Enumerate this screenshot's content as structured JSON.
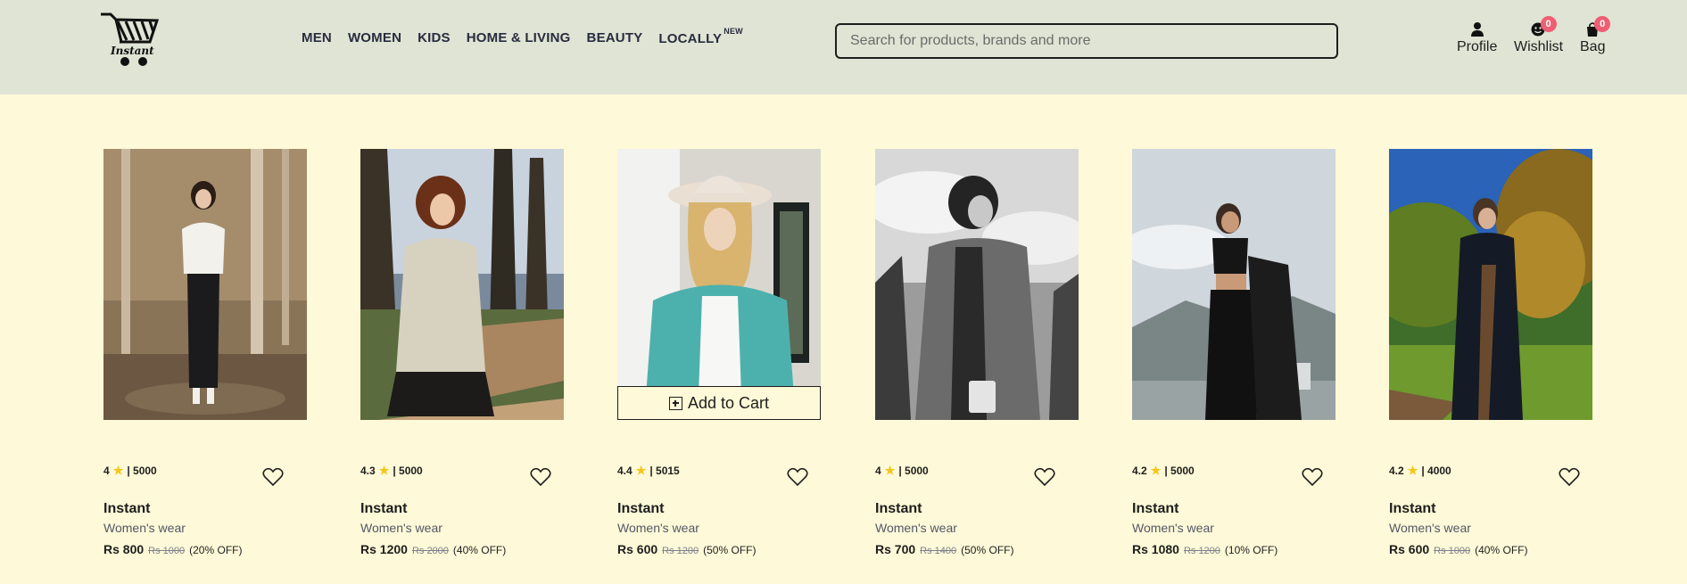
{
  "brand_logo": {
    "text": "Instant",
    "icon": "shopping-cart-logo"
  },
  "nav": [
    {
      "label": "MEN"
    },
    {
      "label": "WOMEN"
    },
    {
      "label": "KIDS"
    },
    {
      "label": "HOME & LIVING"
    },
    {
      "label": "BEAUTY"
    },
    {
      "label": "LOCALLY",
      "badge": "NEW"
    }
  ],
  "search": {
    "placeholder": "Search for products, brands and more",
    "value": ""
  },
  "actions": {
    "profile": {
      "label": "Profile",
      "icon": "user-icon"
    },
    "wishlist": {
      "label": "Wishlist",
      "icon": "wishlist-icon",
      "count": "0"
    },
    "bag": {
      "label": "Bag",
      "icon": "bag-icon",
      "count": "0"
    }
  },
  "colors": {
    "header_bg": "#dfe4d4",
    "page_bg": "#fef9d8",
    "badge": "#ee5f73",
    "star": "#f5c518"
  },
  "add_to_cart_label": "Add to Cart",
  "products": [
    {
      "rating": "4",
      "reviews": "| 5000",
      "brand": "Instant",
      "category": "Women's wear",
      "price": "Rs 800",
      "mrp": "Rs 1000",
      "discount": "(20% OFF)"
    },
    {
      "rating": "4.3",
      "reviews": "| 5000",
      "brand": "Instant",
      "category": "Women's wear",
      "price": "Rs 1200",
      "mrp": "Rs 2000",
      "discount": "(40% OFF)"
    },
    {
      "rating": "4.4",
      "reviews": "| 5015",
      "brand": "Instant",
      "category": "Women's wear",
      "price": "Rs 600",
      "mrp": "Rs 1200",
      "discount": "(50% OFF)"
    },
    {
      "rating": "4",
      "reviews": "| 5000",
      "brand": "Instant",
      "category": "Women's wear",
      "price": "Rs 700",
      "mrp": "Rs 1400",
      "discount": "(50% OFF)"
    },
    {
      "rating": "4.2",
      "reviews": "| 5000",
      "brand": "Instant",
      "category": "Women's wear",
      "price": "Rs 1080",
      "mrp": "Rs 1200",
      "discount": "(10% OFF)"
    },
    {
      "rating": "4.2",
      "reviews": "| 4000",
      "brand": "Instant",
      "category": "Women's wear",
      "price": "Rs 600",
      "mrp": "Rs 1000",
      "discount": "(40% OFF)"
    }
  ]
}
